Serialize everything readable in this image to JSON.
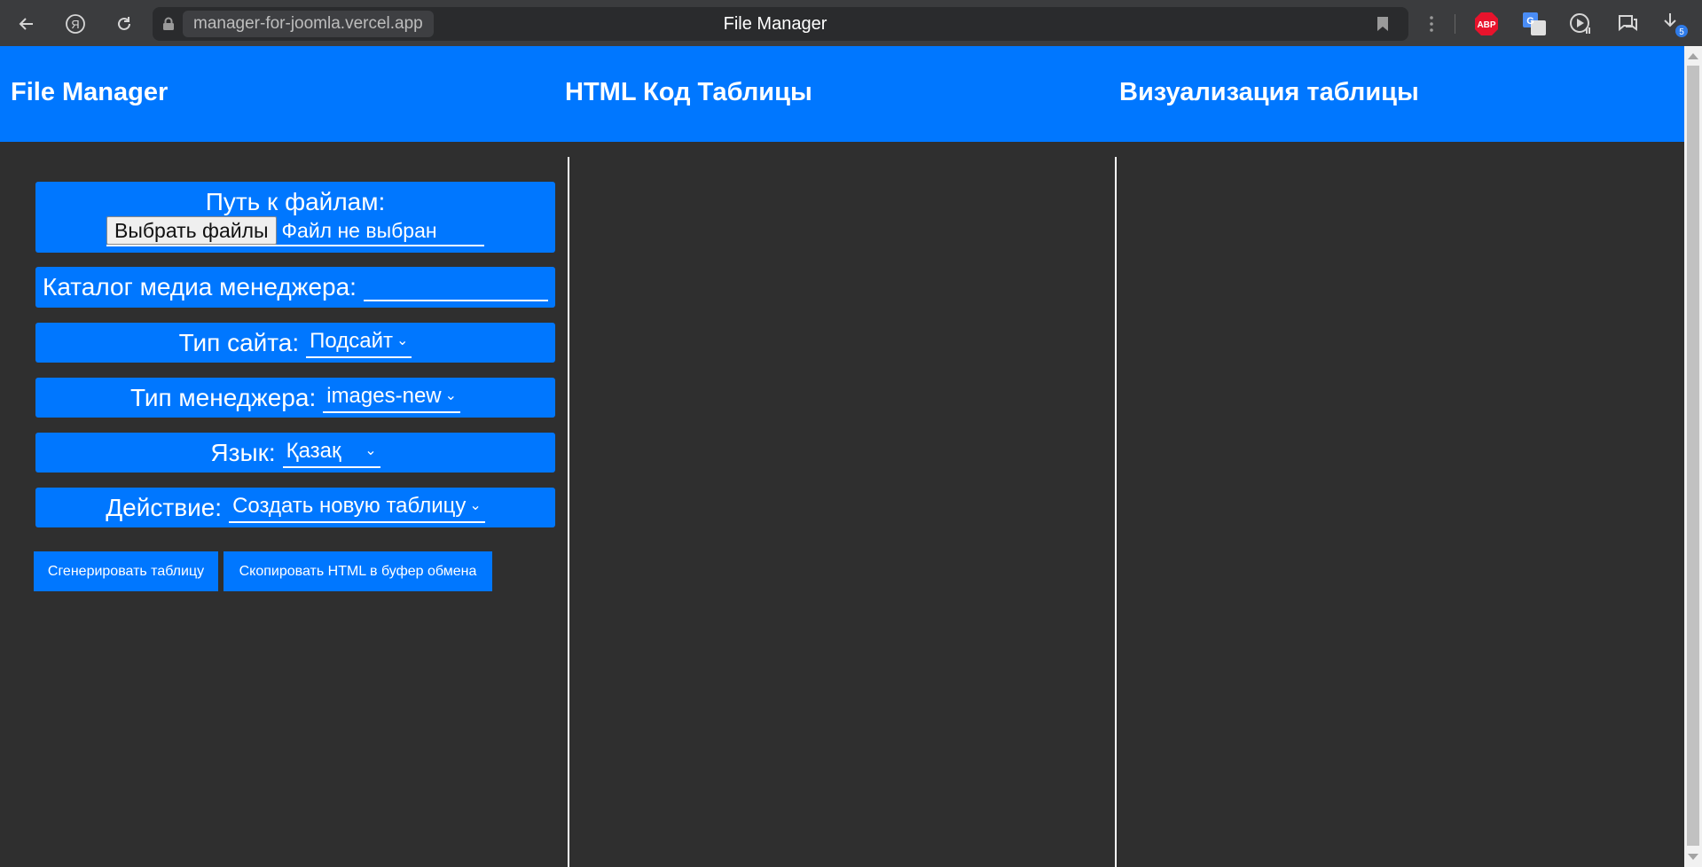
{
  "browser": {
    "url": "manager-for-joomla.vercel.app",
    "tab_title": "File Manager",
    "abp_label": "ABP",
    "translate_label": "G",
    "download_badge": "5"
  },
  "header": {
    "col1_title": "File Manager",
    "col2_title": "HTML Код Таблицы",
    "col3_title": "Визуализация таблицы"
  },
  "form": {
    "files_path_label": "Путь к файлам:",
    "choose_files_button": "Выбрать файлы",
    "no_file_text": "Файл не выбран",
    "media_catalog_label": "Каталог медиа менеджера:",
    "media_catalog_value": "",
    "site_type_label": "Тип сайта:",
    "site_type_value": "Подсайт",
    "manager_type_label": "Тип менеджера:",
    "manager_type_value": "images-new",
    "language_label": "Язык:",
    "language_value": "Қазақ",
    "action_label": "Действие:",
    "action_value": "Создать новую таблицу"
  },
  "buttons": {
    "generate": "Сгенерировать таблицу",
    "copy_html": "Скопировать HTML в буфер обмена"
  },
  "colors": {
    "accent": "#0077ff",
    "background": "#2f2f2f",
    "chrome": "#3b3c3e"
  }
}
